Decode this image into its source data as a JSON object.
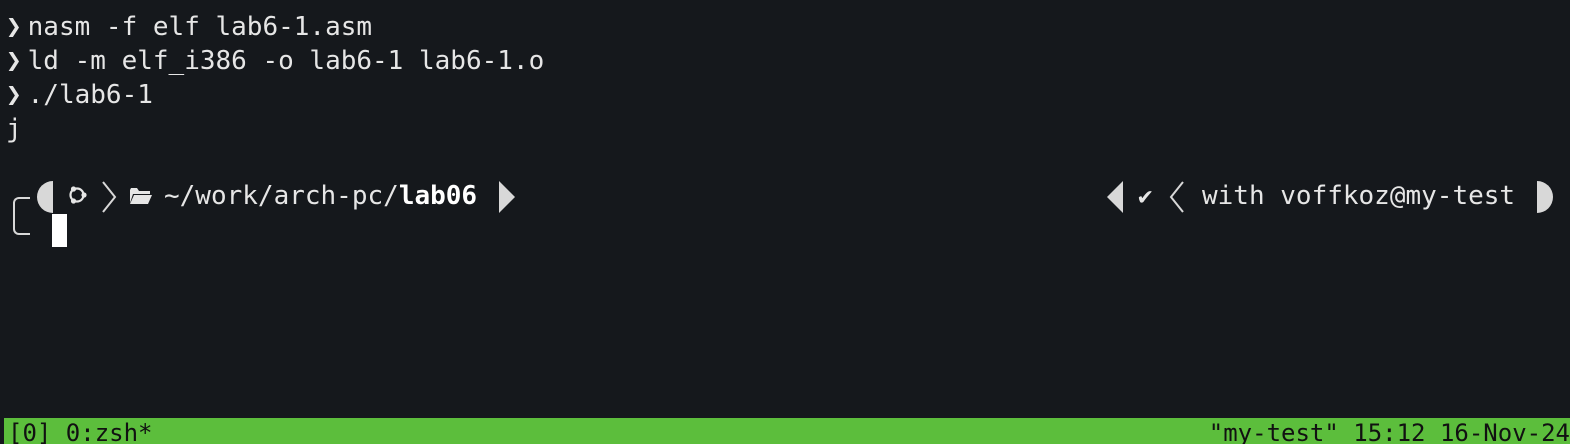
{
  "terminal": {
    "prompt_symbol": "❯",
    "history": [
      {
        "command": "nasm -f elf lab6-1.asm"
      },
      {
        "command": "ld -m elf_i386 -o lab6-1 lab6-1.o"
      },
      {
        "command": "./lab6-1"
      }
    ],
    "output": "j"
  },
  "prompt": {
    "os_icon": "ubuntu-icon",
    "folder_icon": "folder-open-icon",
    "path_prefix": "~/work/arch-pc/",
    "path_current": "lab06",
    "status_symbol": "✔",
    "context": "with voffkoz@my-test"
  },
  "tmux": {
    "left": "[0] 0:zsh*",
    "right": "\"my-test\" 15:12 16-Nov-24",
    "color": "#5cbe3c"
  },
  "colors": {
    "background": "#15181c",
    "foreground": "#e6e6e6"
  }
}
